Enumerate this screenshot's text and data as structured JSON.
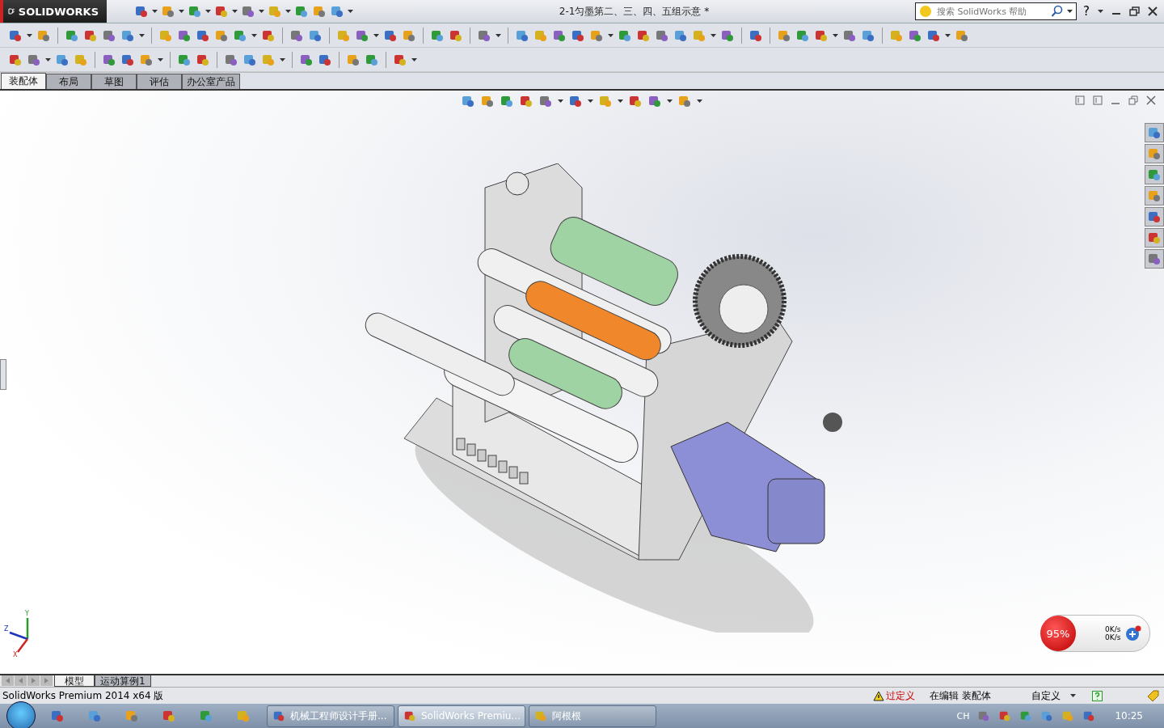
{
  "window": {
    "logo": "SOLIDWORKS",
    "title": "2-1匀墨第二、三、四、五组示意 *",
    "help": "?"
  },
  "search": {
    "placeholder": "搜索 SolidWorks 帮助"
  },
  "tabs": [
    {
      "label": "装配体",
      "selected": true
    },
    {
      "label": "布局",
      "selected": false
    },
    {
      "label": "草图",
      "selected": false
    },
    {
      "label": "评估",
      "selected": false
    },
    {
      "label": "办公室产品",
      "selected": false
    }
  ],
  "viewport": {
    "axes": [
      "Y",
      "Z",
      "X"
    ]
  },
  "net_widget": {
    "percent": "95%",
    "upload": "0K/s",
    "download": "0K/s"
  },
  "bottom_tabs": [
    {
      "label": "模型",
      "selected": true
    },
    {
      "label": "运动算例1",
      "selected": false
    }
  ],
  "status_bar": {
    "product": "SolidWorks Premium 2014 x64 版",
    "warning": "过定义",
    "mode": "在编辑 装配体",
    "units": "自定义"
  },
  "taskbar": {
    "tasks": [
      {
        "label": "机械工程师设计手册...",
        "selected": false
      },
      {
        "label": "SolidWorks Premiu...",
        "selected": true
      },
      {
        "label": "阿根根",
        "selected": false
      }
    ],
    "language": "CH",
    "clock": "10:25"
  }
}
